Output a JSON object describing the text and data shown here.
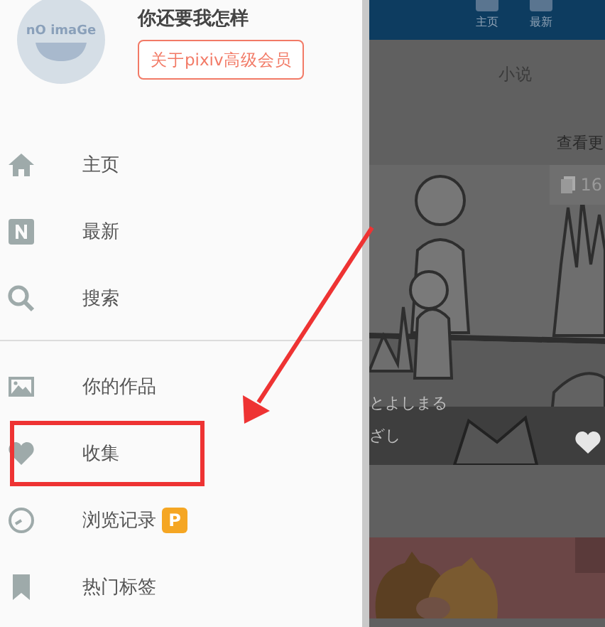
{
  "drawer": {
    "avatar_text": "nO imaGe",
    "user_name": "你还要我怎样",
    "premium_button": "关于pixiv高级会员",
    "sections": [
      [
        {
          "label": "主页"
        },
        {
          "label": "最新"
        },
        {
          "label": "搜索"
        }
      ],
      [
        {
          "label": "你的作品"
        },
        {
          "label": "收集"
        },
        {
          "label": "浏览记录",
          "badge": "P"
        },
        {
          "label": "热门标签"
        }
      ]
    ]
  },
  "background": {
    "tabs": [
      {
        "label": "主页"
      },
      {
        "label": "最新"
      }
    ],
    "section_title": "小说",
    "more_link": "查看更",
    "card": {
      "count": "16",
      "captions": [
        "とよしまる",
        "ざし"
      ]
    }
  }
}
